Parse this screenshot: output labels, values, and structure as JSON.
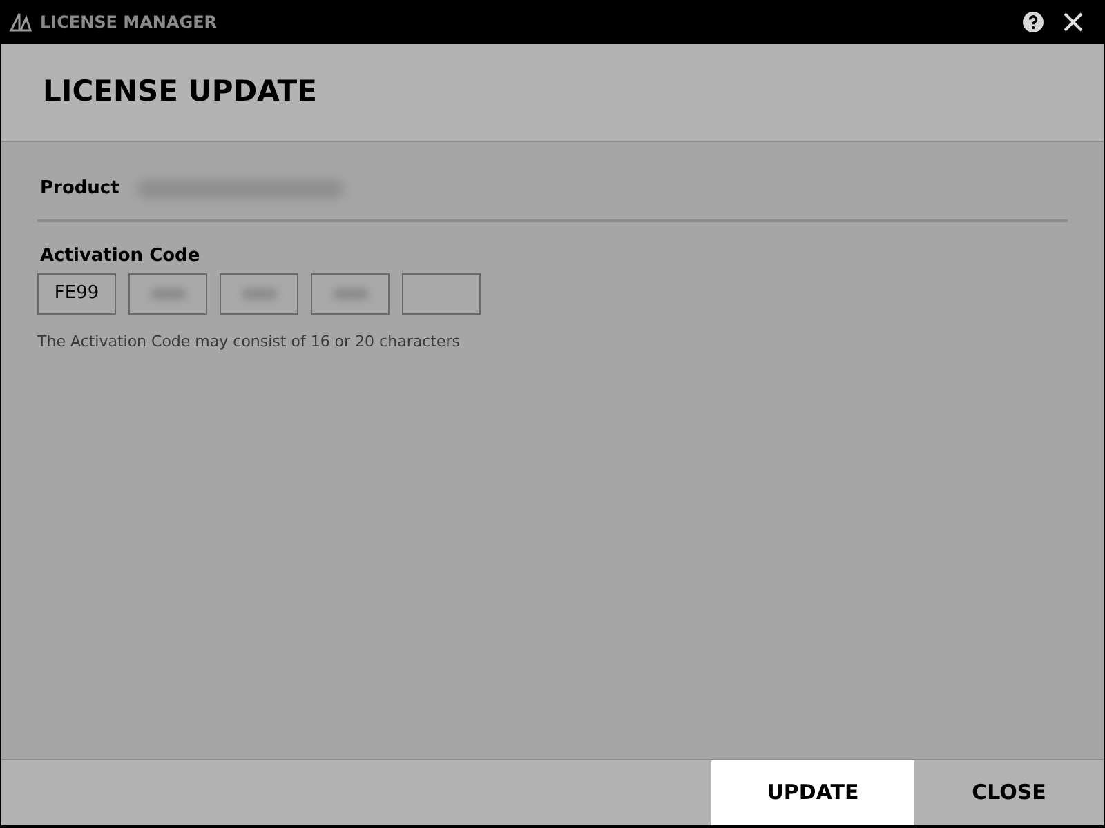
{
  "window": {
    "title": "LICENSE MANAGER"
  },
  "header": {
    "title": "LICENSE UPDATE"
  },
  "product": {
    "label": "Product",
    "value_redacted": true
  },
  "activation": {
    "label": "Activation Code",
    "fields": [
      {
        "value": "FE99",
        "redacted": false
      },
      {
        "redacted": true
      },
      {
        "redacted": true
      },
      {
        "redacted": true
      },
      {
        "redacted": false
      }
    ],
    "hint": "The Activation Code may consist of 16 or 20 characters"
  },
  "buttons": [
    {
      "label": "UPDATE",
      "primary": true
    },
    {
      "label": "CLOSE",
      "primary": false
    }
  ]
}
